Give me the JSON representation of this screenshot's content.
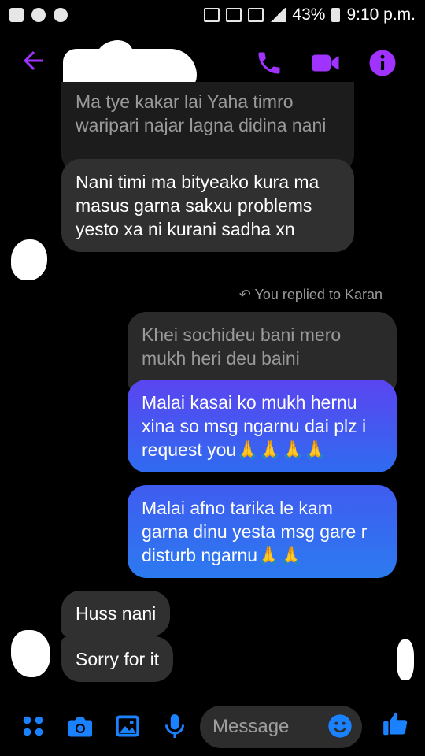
{
  "status_bar": {
    "battery": "43%",
    "time": "9:10 p.m."
  },
  "header": {
    "icons": [
      "back-arrow-icon",
      "phone-call-icon",
      "video-call-icon",
      "info-icon"
    ],
    "accent": "#a033ff"
  },
  "messages": {
    "incoming_quote": "Ma tye kakar lai Yaha timro waripari najar lagna didina nani",
    "incoming_1": "Nani timi ma bityeako kura ma masus garna sakxu problems yesto xa ni kurani sadha xn",
    "reply_note": "You replied to Karan",
    "reply_quoted": "Khei sochideu bani mero mukh heri deu baini",
    "outgoing_1": "Malai kasai ko mukh hernu xina so msg ngarnu dai plz i request you🙏🙏🙏🙏",
    "outgoing_2": "Malai afno tarika le kam garna dinu yesta msg gare r disturb ngarnu🙏🙏",
    "incoming_2": "Huss nani",
    "incoming_3": "Sorry for it"
  },
  "composer": {
    "placeholder": "Message",
    "icons": [
      "apps-icon",
      "camera-icon",
      "gallery-icon",
      "microphone-icon",
      "emoji-icon",
      "thumbs-up-icon"
    ],
    "accent": "#1a82ff"
  }
}
